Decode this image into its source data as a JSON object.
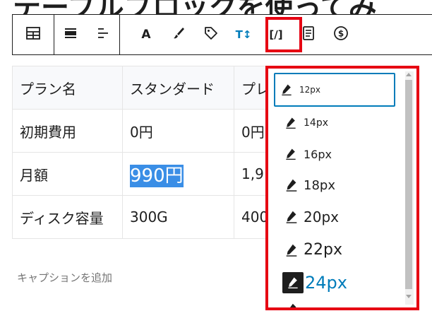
{
  "heading": {
    "text": "テーブルブロックを使ってみ"
  },
  "toolbar": {
    "buttons": [
      {
        "name": "table-icon"
      },
      {
        "name": "align-full-icon"
      },
      {
        "name": "align-text-icon"
      },
      {
        "name": "text-color-icon",
        "glyph": "A"
      },
      {
        "name": "highlight-brush-icon"
      },
      {
        "name": "tag-icon"
      },
      {
        "name": "font-size-icon",
        "glyph": "T↕"
      },
      {
        "name": "inline-code-icon",
        "glyph": "[/]"
      },
      {
        "name": "document-icon"
      },
      {
        "name": "dollar-icon"
      }
    ],
    "active_color": "#007cba"
  },
  "table": {
    "rows": [
      [
        "プラン名",
        "スタンダード",
        "プレ"
      ],
      [
        "初期費用",
        "0円",
        "0円"
      ],
      [
        "月額",
        "990円",
        "1,9"
      ],
      [
        "ディスク容量",
        "300G",
        "400"
      ]
    ],
    "selected_value": "990円"
  },
  "caption": {
    "placeholder": "キャプションを追加"
  },
  "font_size_menu": {
    "items": [
      {
        "label": "12px",
        "size": 12
      },
      {
        "label": "14px",
        "size": 14
      },
      {
        "label": "16px",
        "size": 16
      },
      {
        "label": "18px",
        "size": 18
      },
      {
        "label": "20px",
        "size": 20
      },
      {
        "label": "22px",
        "size": 22
      },
      {
        "label": "24px",
        "size": 24
      }
    ],
    "focused": "12px",
    "selected": "24px"
  },
  "colors": {
    "highlight_border": "#e60012",
    "selection": "#3a8ee6",
    "accent": "#007cba"
  }
}
